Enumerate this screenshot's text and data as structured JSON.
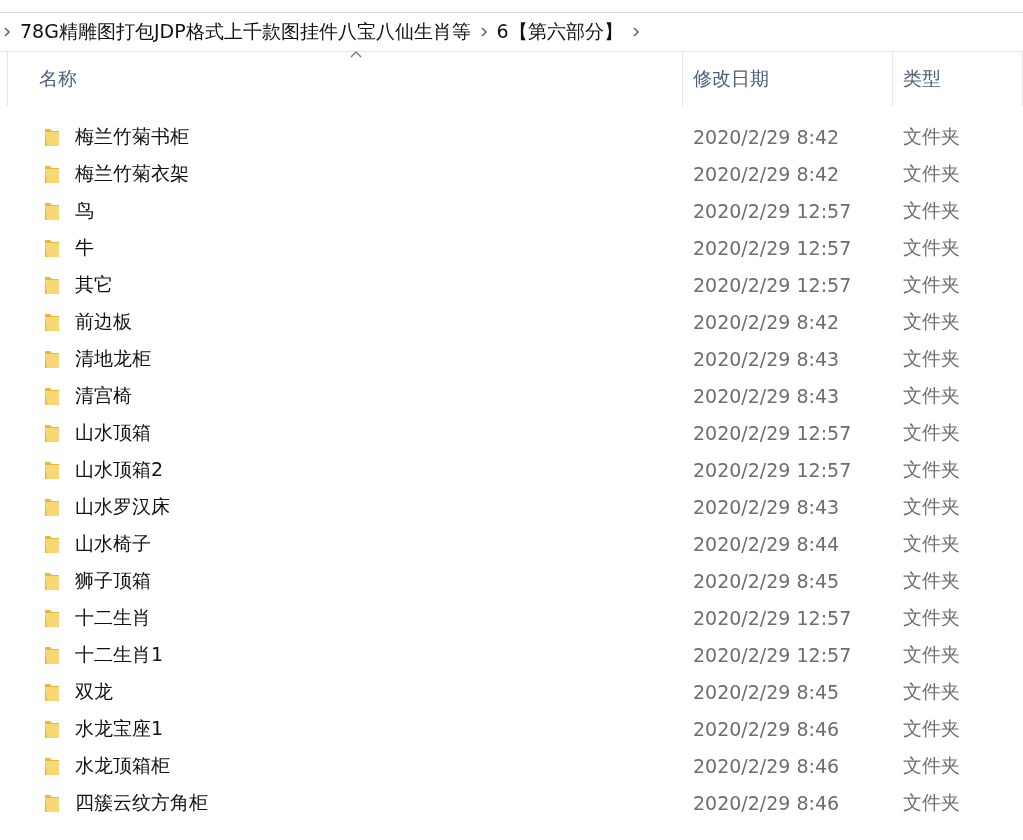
{
  "breadcrumb": [
    "78G精雕图打包JDP格式上千款图挂件八宝八仙生肖等",
    "6【第六部分】"
  ],
  "columns": [
    "名称",
    "修改日期",
    "类型"
  ],
  "rows": [
    {
      "name": "梅兰竹菊书柜",
      "modified": "2020/2/29 8:42",
      "type": "文件夹"
    },
    {
      "name": "梅兰竹菊衣架",
      "modified": "2020/2/29 8:42",
      "type": "文件夹"
    },
    {
      "name": "鸟",
      "modified": "2020/2/29 12:57",
      "type": "文件夹"
    },
    {
      "name": "牛",
      "modified": "2020/2/29 12:57",
      "type": "文件夹"
    },
    {
      "name": "其它",
      "modified": "2020/2/29 12:57",
      "type": "文件夹"
    },
    {
      "name": "前边板",
      "modified": "2020/2/29 8:42",
      "type": "文件夹"
    },
    {
      "name": "清地龙柜",
      "modified": "2020/2/29 8:43",
      "type": "文件夹"
    },
    {
      "name": "清宫椅",
      "modified": "2020/2/29 8:43",
      "type": "文件夹"
    },
    {
      "name": "山水顶箱",
      "modified": "2020/2/29 12:57",
      "type": "文件夹"
    },
    {
      "name": "山水顶箱2",
      "modified": "2020/2/29 12:57",
      "type": "文件夹"
    },
    {
      "name": "山水罗汉床",
      "modified": "2020/2/29 8:43",
      "type": "文件夹"
    },
    {
      "name": "山水椅子",
      "modified": "2020/2/29 8:44",
      "type": "文件夹"
    },
    {
      "name": "狮子顶箱",
      "modified": "2020/2/29 8:45",
      "type": "文件夹"
    },
    {
      "name": "十二生肖",
      "modified": "2020/2/29 12:57",
      "type": "文件夹"
    },
    {
      "name": "十二生肖1",
      "modified": "2020/2/29 12:57",
      "type": "文件夹"
    },
    {
      "name": "双龙",
      "modified": "2020/2/29 8:45",
      "type": "文件夹"
    },
    {
      "name": "水龙宝座1",
      "modified": "2020/2/29 8:46",
      "type": "文件夹"
    },
    {
      "name": "水龙顶箱柜",
      "modified": "2020/2/29 8:46",
      "type": "文件夹"
    },
    {
      "name": "四簇云纹方角柜",
      "modified": "2020/2/29 8:46",
      "type": "文件夹"
    }
  ]
}
